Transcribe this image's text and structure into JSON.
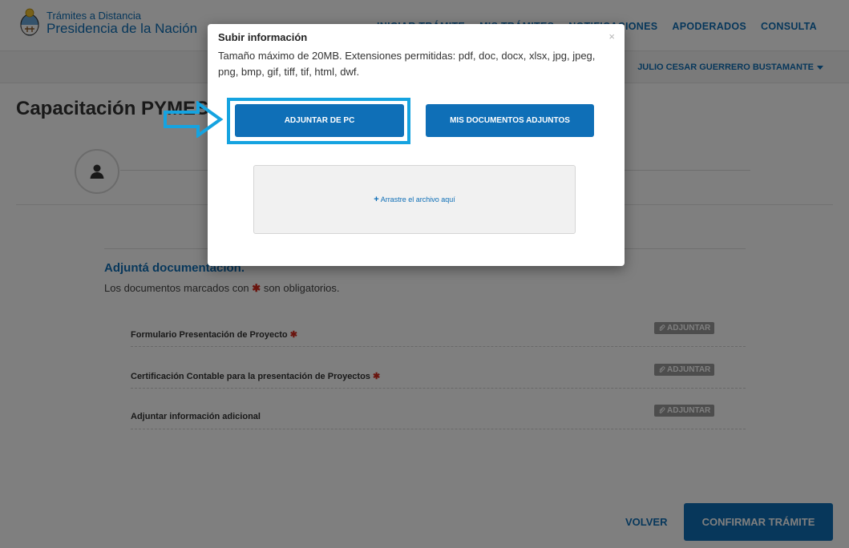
{
  "header": {
    "logo_line1": "Trámites a Distancia",
    "logo_line2": "Presidencia de la Nación",
    "nav": [
      "INICIAR TRÁMITE",
      "MIS TRÁMITES",
      "NOTIFICACIONES",
      "APODERADOS",
      "CONSULTA"
    ],
    "user_name": "JULIO CESAR GUERRERO BUSTAMANTE"
  },
  "page": {
    "title": "Capacitación PYMES"
  },
  "documents": {
    "title": "Adjuntá documentación.",
    "subtitle_before": "Los documentos marcados con",
    "subtitle_after": "son obligatorios.",
    "required_mark": "✱",
    "rows": [
      {
        "label": "Formulario Presentación de Proyecto",
        "required": true,
        "action": "ADJUNTAR"
      },
      {
        "label": "Certificación Contable para la presentación de Proyectos",
        "required": true,
        "action": "ADJUNTAR"
      },
      {
        "label": "Adjuntar información adicional",
        "required": false,
        "action": "ADJUNTAR"
      }
    ]
  },
  "footer": {
    "back_label": "VOLVER",
    "confirm_label": "CONFIRMAR TRÁMITE"
  },
  "modal": {
    "title": "Subir información",
    "info": "Tamaño máximo de 20MB. Extensiones permitidas: pdf, doc, docx, xlsx, jpg, jpeg, png, bmp, gif, tiff, tif, html, dwf.",
    "close": "×",
    "attach_pc": "ADJUNTAR DE PC",
    "my_docs": "MIS DOCUMENTOS ADJUNTOS",
    "dropzone": "Arrastre el archivo aquí",
    "plus": "+"
  },
  "colors": {
    "primary": "#0f6fb7",
    "highlight": "#15a3e0",
    "required": "#d52b1e",
    "badge": "#9a9a9a"
  }
}
